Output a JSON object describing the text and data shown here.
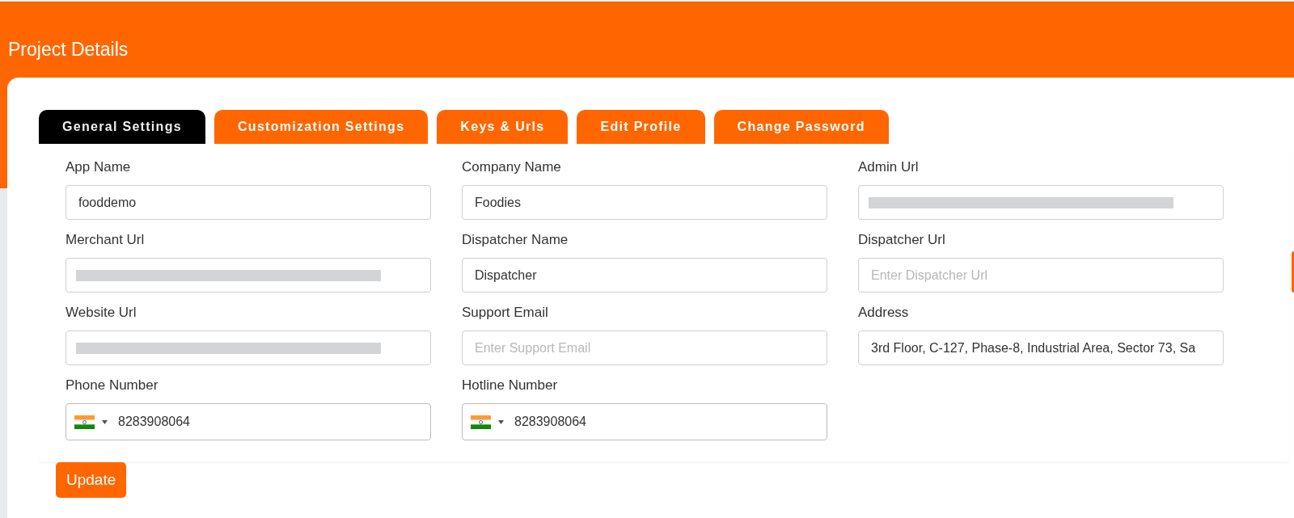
{
  "header": {
    "title": "Project Details"
  },
  "tabs": [
    {
      "label": "General Settings",
      "selected": true
    },
    {
      "label": "Customization Settings",
      "selected": false
    },
    {
      "label": "Keys & Urls",
      "selected": false
    },
    {
      "label": "Edit Profile",
      "selected": false
    },
    {
      "label": "Change Password",
      "selected": false
    }
  ],
  "fields": [
    {
      "kind": "text",
      "label": "App Name",
      "value": "fooddemo"
    },
    {
      "kind": "text",
      "label": "Company Name",
      "value": "Foodies"
    },
    {
      "kind": "redacted",
      "label": "Admin Url"
    },
    {
      "kind": "redacted",
      "label": "Merchant Url"
    },
    {
      "kind": "text",
      "label": "Dispatcher Name",
      "value": "Dispatcher"
    },
    {
      "kind": "text",
      "label": "Dispatcher Url",
      "placeholder": "Enter Dispatcher Url"
    },
    {
      "kind": "redacted",
      "label": "Website Url"
    },
    {
      "kind": "text",
      "label": "Support Email",
      "placeholder": "Enter Support Email"
    },
    {
      "kind": "text",
      "label": "Address",
      "value": "3rd Floor, C-127, Phase-8, Industrial Area, Sector 73, Sa"
    },
    {
      "kind": "phone",
      "label": "Phone Number",
      "value": "8283908064"
    },
    {
      "kind": "phone",
      "label": "Hotline Number",
      "value": "8283908064"
    }
  ],
  "update_button": {
    "label": "Update"
  }
}
